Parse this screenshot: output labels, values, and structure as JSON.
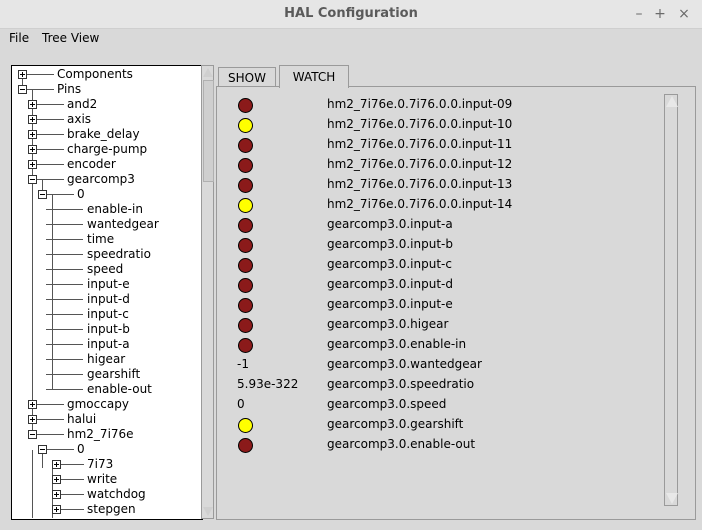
{
  "window": {
    "title": "HAL Configuration",
    "minimize": "–",
    "maximize": "+",
    "close": "×"
  },
  "menu": {
    "file": "File",
    "tree_view": "Tree View"
  },
  "tabs": {
    "show": "SHOW",
    "watch": "WATCH"
  },
  "tree": [
    {
      "label": "Components",
      "level": 0,
      "box": "plus"
    },
    {
      "label": "Pins",
      "level": 0,
      "box": "minus"
    },
    {
      "label": "and2",
      "level": 1,
      "box": "plus"
    },
    {
      "label": "axis",
      "level": 1,
      "box": "plus"
    },
    {
      "label": "brake_delay",
      "level": 1,
      "box": "plus"
    },
    {
      "label": "charge-pump",
      "level": 1,
      "box": "plus"
    },
    {
      "label": "encoder",
      "level": 1,
      "box": "plus"
    },
    {
      "label": "gearcomp3",
      "level": 1,
      "box": "minus"
    },
    {
      "label": "0",
      "level": 2,
      "box": "minus"
    },
    {
      "label": "enable-in",
      "level": 3,
      "box": "none"
    },
    {
      "label": "wantedgear",
      "level": 3,
      "box": "none"
    },
    {
      "label": "time",
      "level": 3,
      "box": "none"
    },
    {
      "label": "speedratio",
      "level": 3,
      "box": "none"
    },
    {
      "label": "speed",
      "level": 3,
      "box": "none"
    },
    {
      "label": "input-e",
      "level": 3,
      "box": "none"
    },
    {
      "label": "input-d",
      "level": 3,
      "box": "none"
    },
    {
      "label": "input-c",
      "level": 3,
      "box": "none"
    },
    {
      "label": "input-b",
      "level": 3,
      "box": "none"
    },
    {
      "label": "input-a",
      "level": 3,
      "box": "none"
    },
    {
      "label": "higear",
      "level": 3,
      "box": "none"
    },
    {
      "label": "gearshift",
      "level": 3,
      "box": "none"
    },
    {
      "label": "enable-out",
      "level": 3,
      "box": "none"
    },
    {
      "label": "gmoccapy",
      "level": 1,
      "box": "plus"
    },
    {
      "label": "halui",
      "level": 1,
      "box": "plus"
    },
    {
      "label": "hm2_7i76e",
      "level": 1,
      "box": "minus"
    },
    {
      "label": "0",
      "level": 2,
      "box": "minus"
    },
    {
      "label": "7i73",
      "level": 3,
      "box": "plus"
    },
    {
      "label": "write",
      "level": 3,
      "box": "plus"
    },
    {
      "label": "watchdog",
      "level": 3,
      "box": "plus"
    },
    {
      "label": "stepgen",
      "level": 3,
      "box": "plus"
    }
  ],
  "watch": [
    {
      "led": "red",
      "value": "",
      "name": "hm2_7i76e.0.7i76.0.0.input-09"
    },
    {
      "led": "yellow",
      "value": "",
      "name": "hm2_7i76e.0.7i76.0.0.input-10"
    },
    {
      "led": "red",
      "value": "",
      "name": "hm2_7i76e.0.7i76.0.0.input-11"
    },
    {
      "led": "red",
      "value": "",
      "name": "hm2_7i76e.0.7i76.0.0.input-12"
    },
    {
      "led": "red",
      "value": "",
      "name": "hm2_7i76e.0.7i76.0.0.input-13"
    },
    {
      "led": "yellow",
      "value": "",
      "name": "hm2_7i76e.0.7i76.0.0.input-14"
    },
    {
      "led": "red",
      "value": "",
      "name": "gearcomp3.0.input-a"
    },
    {
      "led": "red",
      "value": "",
      "name": "gearcomp3.0.input-b"
    },
    {
      "led": "red",
      "value": "",
      "name": "gearcomp3.0.input-c"
    },
    {
      "led": "red",
      "value": "",
      "name": "gearcomp3.0.input-d"
    },
    {
      "led": "red",
      "value": "",
      "name": "gearcomp3.0.input-e"
    },
    {
      "led": "red",
      "value": "",
      "name": "gearcomp3.0.higear"
    },
    {
      "led": "red",
      "value": "",
      "name": "gearcomp3.0.enable-in"
    },
    {
      "led": "none",
      "value": "-1",
      "name": "gearcomp3.0.wantedgear"
    },
    {
      "led": "none",
      "value": "5.93e-322",
      "name": "gearcomp3.0.speedratio"
    },
    {
      "led": "none",
      "value": "0",
      "name": "gearcomp3.0.speed"
    },
    {
      "led": "yellow",
      "value": "",
      "name": "gearcomp3.0.gearshift"
    },
    {
      "led": "red",
      "value": "",
      "name": "gearcomp3.0.enable-out"
    }
  ],
  "colors": {
    "led_on": "#ffff00",
    "led_off": "#8b1a1a"
  }
}
